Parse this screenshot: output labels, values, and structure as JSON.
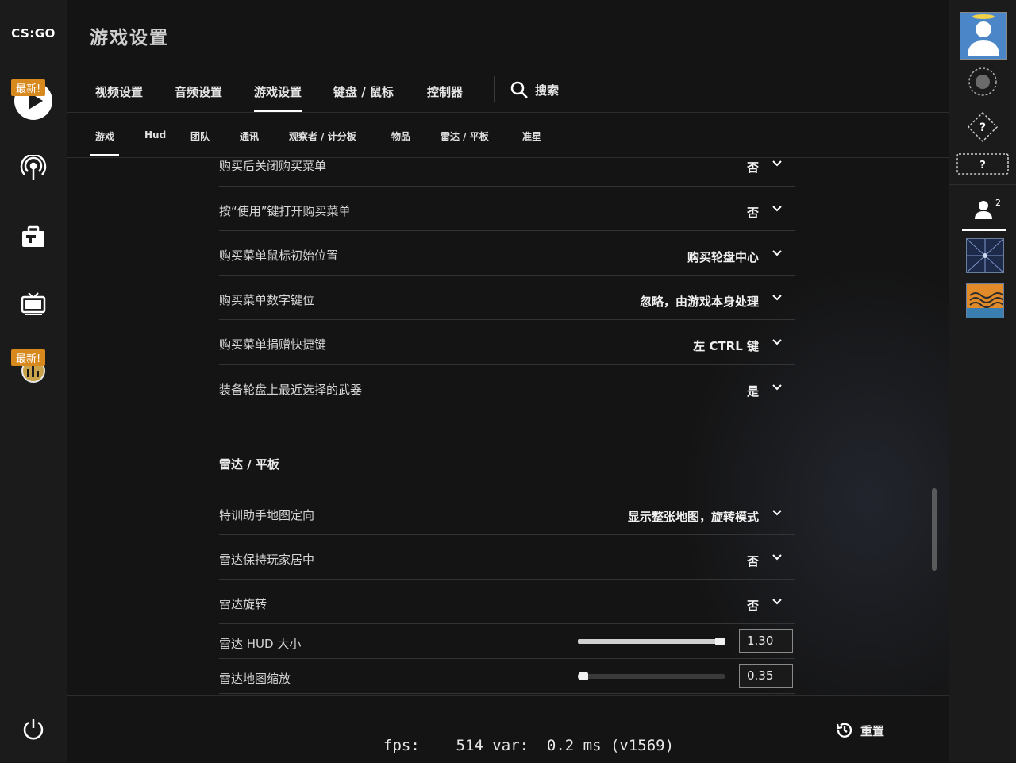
{
  "app": {
    "logo_text": "CS:GO",
    "page_title": "游戏设置"
  },
  "left_nav": {
    "badge_top": "最新!",
    "badge_bottom": "最新!"
  },
  "tabs": [
    "视频设置",
    "音频设置",
    "游戏设置",
    "键盘 / 鼠标",
    "控制器"
  ],
  "active_tab": "游戏设置",
  "search_label": "搜索",
  "subtabs": [
    "游戏",
    "Hud",
    "团队",
    "通讯",
    "观察者 / 计分板",
    "物品",
    "雷达 / 平板",
    "准星"
  ],
  "active_subtab": "游戏",
  "settings": [
    {
      "label": "购买后关闭购买菜单",
      "value": "否"
    },
    {
      "label": "按“使用”键打开购买菜单",
      "value": "否"
    },
    {
      "label": "购买菜单鼠标初始位置",
      "value": "购买轮盘中心"
    },
    {
      "label": "购买菜单数字键位",
      "value": "忽略，由游戏本身处理"
    },
    {
      "label": "购买菜单捐赠快捷键",
      "value": "左 CTRL 键"
    },
    {
      "label": "装备轮盘上最近选择的武器",
      "value": "是"
    }
  ],
  "radar_section": {
    "title": "雷达 / 平板",
    "settings": [
      {
        "label": "特训助手地图定向",
        "value": "显示整张地图，旋转模式"
      },
      {
        "label": "雷达保持玩家居中",
        "value": "否"
      },
      {
        "label": "雷达旋转",
        "value": "否"
      }
    ],
    "sliders": [
      {
        "label": "雷达 HUD 大小",
        "value": "1.30",
        "fraction": 0.98
      },
      {
        "label": "雷达地图缩放",
        "value": "0.35",
        "fraction": 0.04
      }
    ]
  },
  "footer": {
    "fps_text": "fps:    514 var:  0.2 ms (v1569)",
    "reset_label": "重置"
  },
  "right_bar": {
    "friend_count": "2"
  },
  "colors": {
    "accent_badge": "#d8891e",
    "background": "#141414",
    "sidebar": "#1b1b1b"
  }
}
